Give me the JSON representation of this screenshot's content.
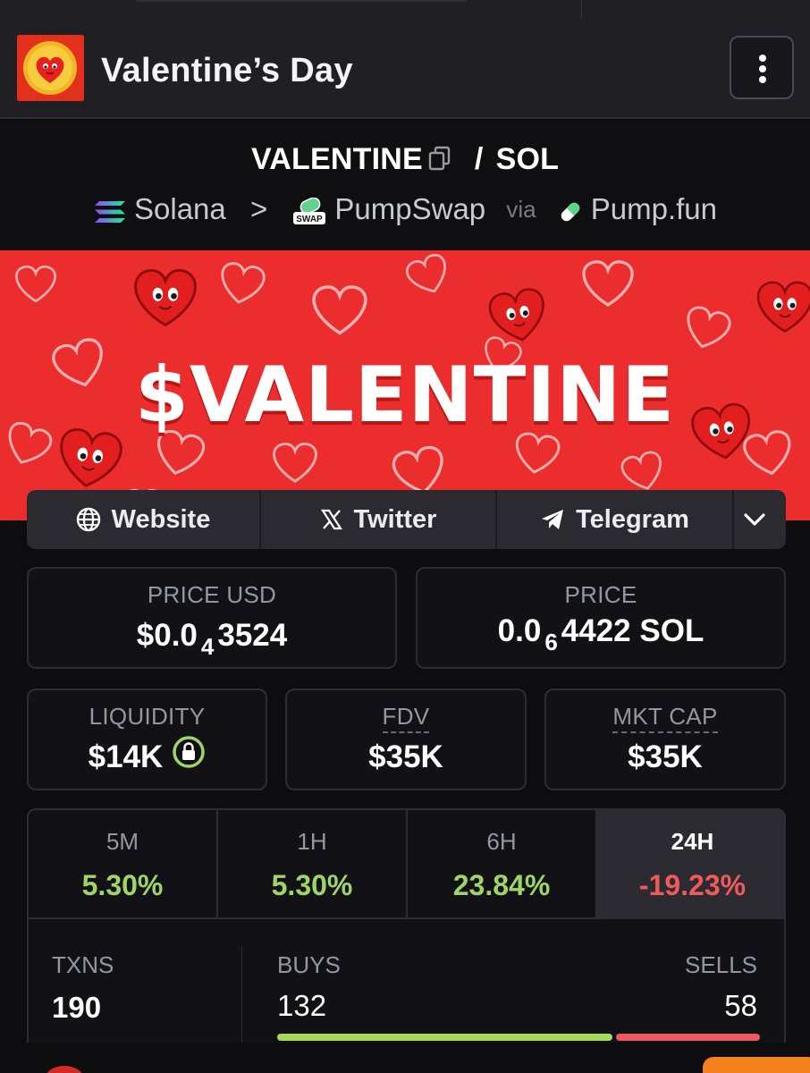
{
  "header": {
    "title": "Valentine’s Day",
    "logo_icon": "heart-coin-logo",
    "menu_icon": "vertical-dots-icon"
  },
  "pair": {
    "base": "VALENTINE",
    "quote": "SOL",
    "separator": "/",
    "copy_icon": "copy-icon",
    "chain": "Solana",
    "dex": "PumpSwap",
    "via": "via",
    "launchpad": "Pump.fun",
    "chevron": ">"
  },
  "banner": {
    "text": "$VALENTINE"
  },
  "links": {
    "website": "Website",
    "twitter": "Twitter",
    "telegram": "Telegram"
  },
  "price_usd": {
    "label": "PRICE USD",
    "prefix": "$0.0",
    "zeros": "4",
    "digits": "3524"
  },
  "price_native": {
    "label": "PRICE",
    "prefix": "0.0",
    "zeros": "6",
    "digits": "4422",
    "unit": "SOL"
  },
  "liquidity": {
    "label": "LIQUIDITY",
    "value": "$14K"
  },
  "fdv": {
    "label": "FDV",
    "value": "$35K"
  },
  "mkt_cap": {
    "label": "MKT CAP",
    "value": "$35K"
  },
  "changes": [
    {
      "label": "5M",
      "value": "5.30%"
    },
    {
      "label": "1H",
      "value": "5.30%"
    },
    {
      "label": "6H",
      "value": "23.84%"
    },
    {
      "label": "24H",
      "value": "-19.23%"
    }
  ],
  "txns": {
    "label": "TXNS",
    "value": "190",
    "buys_label": "BUYS",
    "buys": "132",
    "sells_label": "SELLS",
    "sells": "58",
    "buy_fraction": 0.695
  },
  "colors": {
    "positive": "#9fd466",
    "negative": "#ef5a5a",
    "banner": "#ec2d2d",
    "accent": "#f5821f"
  }
}
